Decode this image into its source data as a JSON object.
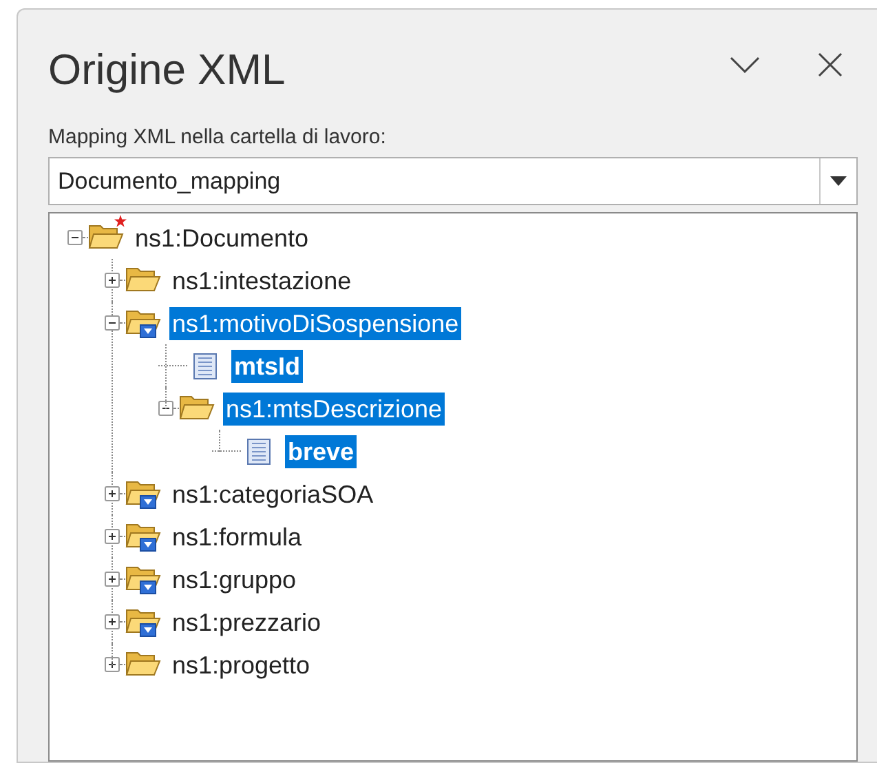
{
  "pane": {
    "title": "Origine XML",
    "mappings_label": "Mapping XML nella cartella di lavoro:",
    "mapping_select": {
      "value": "Documento_mapping"
    }
  },
  "tree": [
    {
      "label": "ns1:Documento",
      "kind": "folder",
      "expanded": true,
      "selected": false,
      "mapped": false,
      "starred": true,
      "children": [
        {
          "label": "ns1:intestazione",
          "kind": "folder",
          "expanded": false,
          "selected": false,
          "mapped": false
        },
        {
          "label": "ns1:motivoDiSospensione",
          "kind": "folder",
          "expanded": true,
          "selected": true,
          "mapped": true,
          "children": [
            {
              "label": "mtsId",
              "kind": "element",
              "selected": true
            },
            {
              "label": "ns1:mtsDescrizione",
              "kind": "folder",
              "expanded": true,
              "selected": true,
              "mapped": false,
              "children": [
                {
                  "label": "breve",
                  "kind": "element",
                  "selected": true
                }
              ]
            }
          ]
        },
        {
          "label": "ns1:categoriaSOA",
          "kind": "folder",
          "expanded": false,
          "selected": false,
          "mapped": true
        },
        {
          "label": "ns1:formula",
          "kind": "folder",
          "expanded": false,
          "selected": false,
          "mapped": true
        },
        {
          "label": "ns1:gruppo",
          "kind": "folder",
          "expanded": false,
          "selected": false,
          "mapped": true
        },
        {
          "label": "ns1:prezzario",
          "kind": "folder",
          "expanded": false,
          "selected": false,
          "mapped": true
        },
        {
          "label": "ns1:progetto",
          "kind": "folder",
          "expanded": false,
          "selected": false,
          "mapped": false
        }
      ]
    }
  ]
}
